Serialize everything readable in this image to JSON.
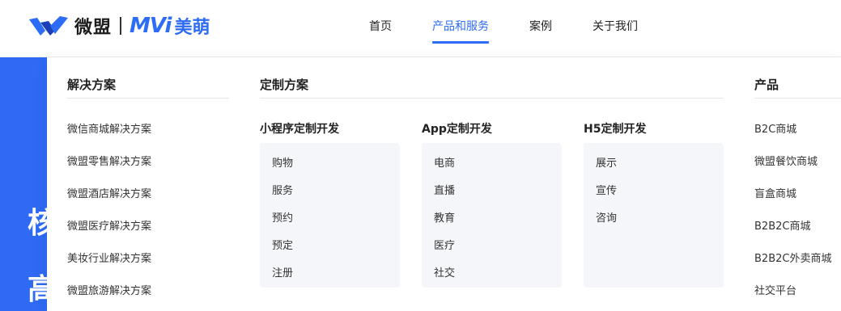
{
  "header": {
    "logo": {
      "brand_cn": "微盟",
      "brand_mark": "MVi",
      "brand_sub": "美萌"
    },
    "nav": [
      {
        "label": "首页",
        "active": false
      },
      {
        "label": "产品和服务",
        "active": true
      },
      {
        "label": "案例",
        "active": false
      },
      {
        "label": "关于我们",
        "active": false
      }
    ],
    "accent_color": "#2d6cf6"
  },
  "hero": {
    "glyph_1": "核",
    "glyph_2": "高"
  },
  "dropdown": {
    "solutions": {
      "title": "解决方案",
      "items": [
        "微信商城解决方案",
        "微盟零售解决方案",
        "微盟酒店解决方案",
        "微盟医疗解决方案",
        "美妆行业解决方案",
        "微盟旅游解决方案"
      ]
    },
    "custom": {
      "title": "定制方案",
      "groups": [
        {
          "title": "小程序定制开发",
          "items": [
            "购物",
            "服务",
            "预约",
            "预定",
            "注册"
          ]
        },
        {
          "title": "App定制开发",
          "items": [
            "电商",
            "直播",
            "教育",
            "医疗",
            "社交"
          ]
        },
        {
          "title": "H5定制开发",
          "items": [
            "展示",
            "宣传",
            "咨询"
          ]
        }
      ]
    },
    "products": {
      "title": "产品",
      "items": [
        "B2C商城",
        "微盟餐饮商城",
        "盲盒商城",
        "B2B2C商城",
        "B2B2C外卖商城",
        "社交平台"
      ]
    }
  }
}
